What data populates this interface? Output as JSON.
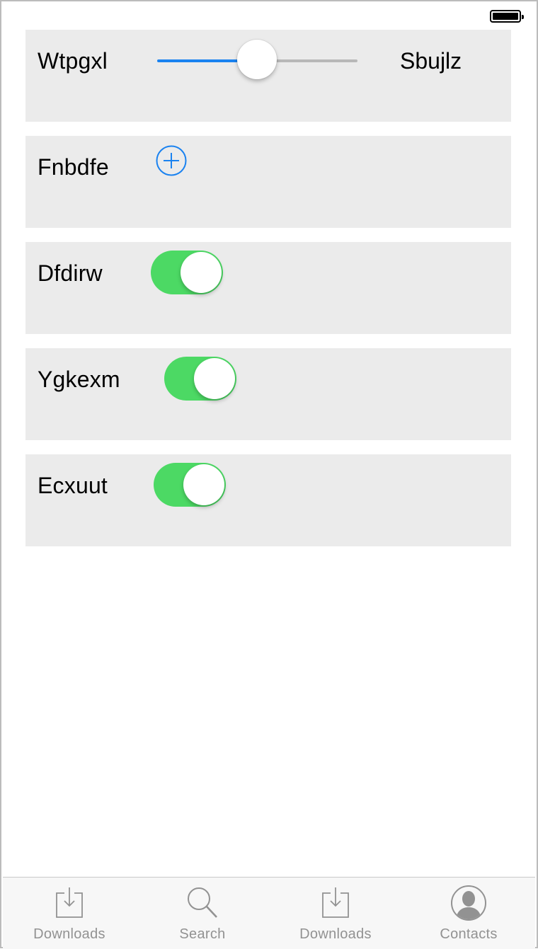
{
  "status_bar": {
    "battery": "full"
  },
  "rows": {
    "slider": {
      "label": "Wtpgxl",
      "right_label": "Sbujlz",
      "value_fraction": 0.5,
      "track_color": "#1a82f0"
    },
    "add": {
      "label": "Fnbdfe",
      "icon": "plus-circle-icon",
      "icon_color": "#1a82f0"
    },
    "toggle1": {
      "label": "Dfdirw",
      "on": true
    },
    "toggle2": {
      "label": "Ygkexm",
      "on": true
    },
    "toggle3": {
      "label": "Ecxuut",
      "on": true
    }
  },
  "toggle_on_color": "#4cd964",
  "tabbar": {
    "tabs": [
      {
        "label": "Downloads",
        "icon": "download-icon"
      },
      {
        "label": "Search",
        "icon": "search-icon"
      },
      {
        "label": "Downloads",
        "icon": "download-icon"
      },
      {
        "label": "Contacts",
        "icon": "contact-icon"
      }
    ]
  }
}
